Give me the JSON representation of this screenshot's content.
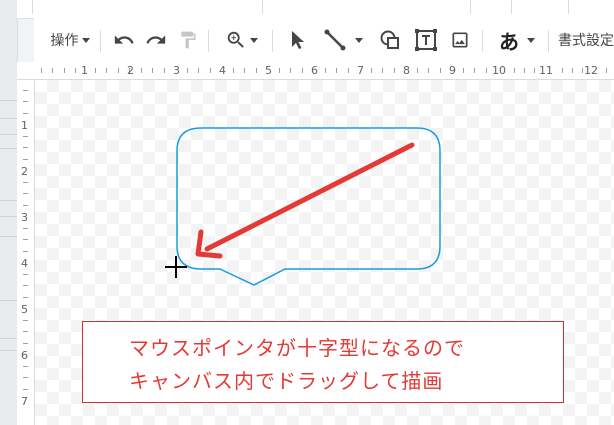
{
  "toolbar": {
    "actions_label": "操作",
    "text_style_glyph": "あ",
    "format_options_label": "書式設定"
  },
  "ruler": {
    "horizontal_numbers": [
      "1",
      "2",
      "3",
      "4",
      "5",
      "6",
      "7",
      "8",
      "9",
      "10",
      "11",
      "12"
    ],
    "vertical_numbers": [
      "1",
      "2",
      "3",
      "4",
      "5",
      "6",
      "7"
    ]
  },
  "annotation": {
    "line1": "マウスポインタが十字型になるので",
    "line2": "キャンバス内でドラッグして描画"
  },
  "colors": {
    "callout_border": "#1a9be0",
    "arrow": "#e53935",
    "annotation_text": "#e53935",
    "annotation_border": "#d32f2f"
  },
  "icons": [
    "undo-icon",
    "redo-icon",
    "paint-format-icon",
    "zoom-icon",
    "select-icon",
    "line-icon",
    "shape-icon",
    "text-box-icon",
    "image-icon",
    "crosshair-cursor-icon"
  ]
}
